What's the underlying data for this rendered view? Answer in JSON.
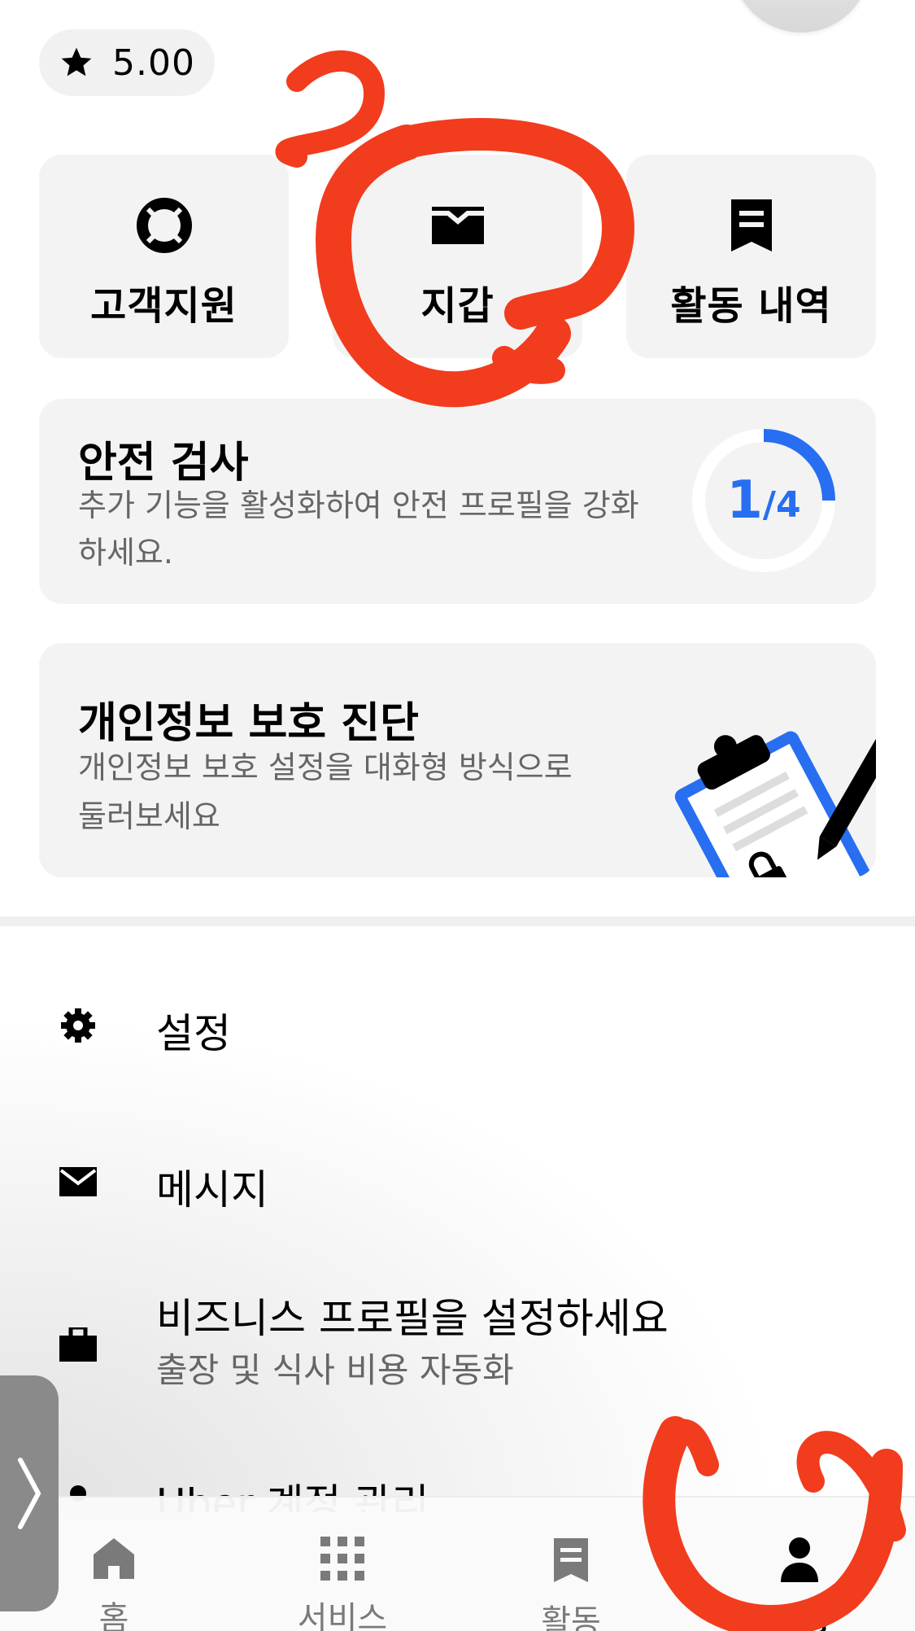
{
  "rating": {
    "value": "5.00",
    "icon": "star-icon"
  },
  "quick_actions": [
    {
      "label": "고객지원",
      "icon": "lifebuoy-icon"
    },
    {
      "label": "지갑",
      "icon": "wallet-icon"
    },
    {
      "label": "활동 내역",
      "icon": "receipt-icon"
    }
  ],
  "safety_check": {
    "title": "안전 검사",
    "description_line1": "추가 기능을 활성화하여 안전 프로필을 강화",
    "description_line2": "하세요.",
    "progress_numerator": "1",
    "progress_denominator": "/4",
    "progress_fraction": 0.25,
    "accent_color": "#276EF1"
  },
  "privacy_checkup": {
    "title": "개인정보 보호 진단",
    "description_line1": "개인정보 보호 설정을 대화형 방식으로",
    "description_line2": "둘러보세요",
    "illustration": "clipboard-lock-icon"
  },
  "menu": {
    "settings": {
      "label": "설정",
      "icon": "gear-icon"
    },
    "messages": {
      "label": "메시지",
      "icon": "envelope-icon"
    },
    "business": {
      "label": "비즈니스 프로필을 설정하세요",
      "sublabel": "출장 및 식사 비용 자동화",
      "icon": "briefcase-icon"
    },
    "account": {
      "label": "Uber 계정 관리",
      "icon": "person-icon"
    }
  },
  "bottom_nav": [
    {
      "label": "홈",
      "icon": "home-icon",
      "active": false
    },
    {
      "label": "서비스",
      "icon": "grid-icon",
      "active": false
    },
    {
      "label": "활동",
      "icon": "receipt-icon",
      "active": false
    },
    {
      "label": "계정",
      "icon": "person-icon",
      "active": true
    }
  ],
  "colors": {
    "annotation": "#F23C1E",
    "card_bg": "#F3F3F3",
    "accent": "#276EF1"
  }
}
